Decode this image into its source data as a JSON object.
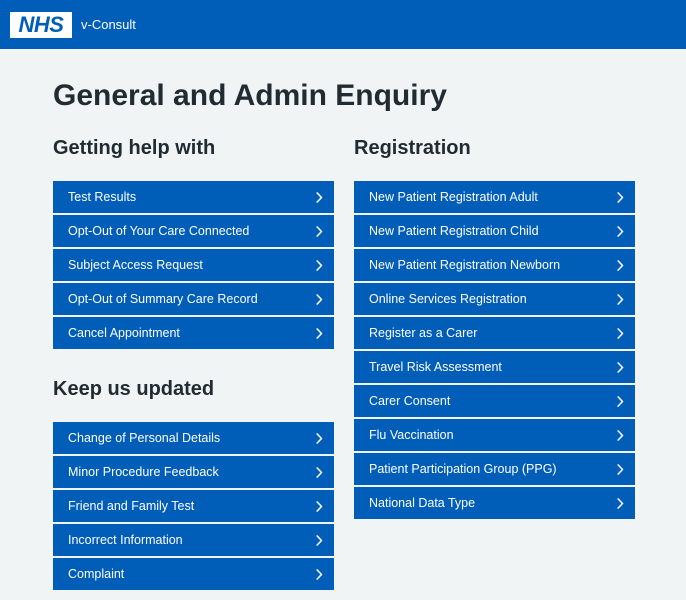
{
  "header": {
    "logo_text": "NHS",
    "service_name": "v-Consult"
  },
  "page": {
    "title": "General and Admin Enquiry"
  },
  "sections": {
    "getting_help": {
      "heading": "Getting help with",
      "items": [
        {
          "label": "Test Results"
        },
        {
          "label": "Opt-Out of Your Care Connected"
        },
        {
          "label": "Subject Access Request"
        },
        {
          "label": "Opt-Out of Summary Care Record"
        },
        {
          "label": "Cancel Appointment"
        }
      ]
    },
    "keep_updated": {
      "heading": "Keep us updated",
      "items": [
        {
          "label": "Change of Personal Details"
        },
        {
          "label": "Minor Procedure Feedback"
        },
        {
          "label": "Friend and Family Test"
        },
        {
          "label": "Incorrect Information"
        },
        {
          "label": "Complaint"
        }
      ]
    },
    "registration": {
      "heading": "Registration",
      "items": [
        {
          "label": "New Patient Registration Adult"
        },
        {
          "label": "New Patient Registration Child"
        },
        {
          "label": "New Patient Registration Newborn"
        },
        {
          "label": "Online Services Registration"
        },
        {
          "label": "Register as a Carer"
        },
        {
          "label": "Travel Risk Assessment"
        },
        {
          "label": "Carer Consent"
        },
        {
          "label": "Flu Vaccination"
        },
        {
          "label": "Patient Participation Group (PPG)"
        },
        {
          "label": "National Data Type"
        }
      ]
    }
  },
  "icons": {
    "chevron": "chevron-right-icon"
  },
  "colors": {
    "brand_blue": "#005eb8",
    "background": "#f0f4f5",
    "text_dark": "#212b32"
  }
}
